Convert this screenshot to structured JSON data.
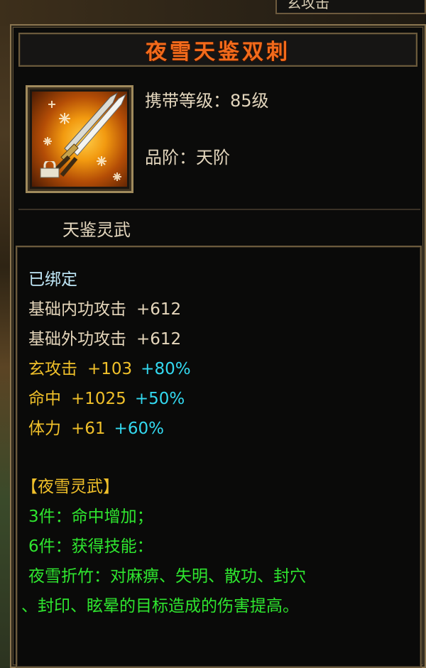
{
  "top_tab": {
    "text": "玄攻击"
  },
  "item": {
    "name": "夜雪天鉴双刺",
    "icon": "twin-daggers-icon",
    "level_label": "携带等级：",
    "level_value": "85级",
    "grade_label": "品阶：",
    "grade_value": "天阶",
    "category": "天鉴灵武"
  },
  "stats": {
    "bound": "已绑定",
    "base": [
      {
        "name": "基础内功攻击",
        "value": "+612"
      },
      {
        "name": "基础外功攻击",
        "value": "+612"
      }
    ],
    "extra": [
      {
        "name": "玄攻击",
        "value": "+103",
        "bonus": "+80%"
      },
      {
        "name": "命中",
        "value": "+1025",
        "bonus": "+50%"
      },
      {
        "name": "体力",
        "value": "+61",
        "bonus": "+60%"
      }
    ],
    "set_title": "【夜雪灵武】",
    "set_lines": [
      "3件：命中增加；",
      "6件：获得技能：",
      "夜雪折竹：对麻痹、失明、散功、封穴",
      "、封印、眩晕的目标造成的伤害提高。"
    ]
  },
  "colors": {
    "title": "#f26a1b",
    "gold": "#f0c02a",
    "cyan": "#33d9f0",
    "green": "#2fe62f",
    "bound": "#bfe7f7"
  }
}
